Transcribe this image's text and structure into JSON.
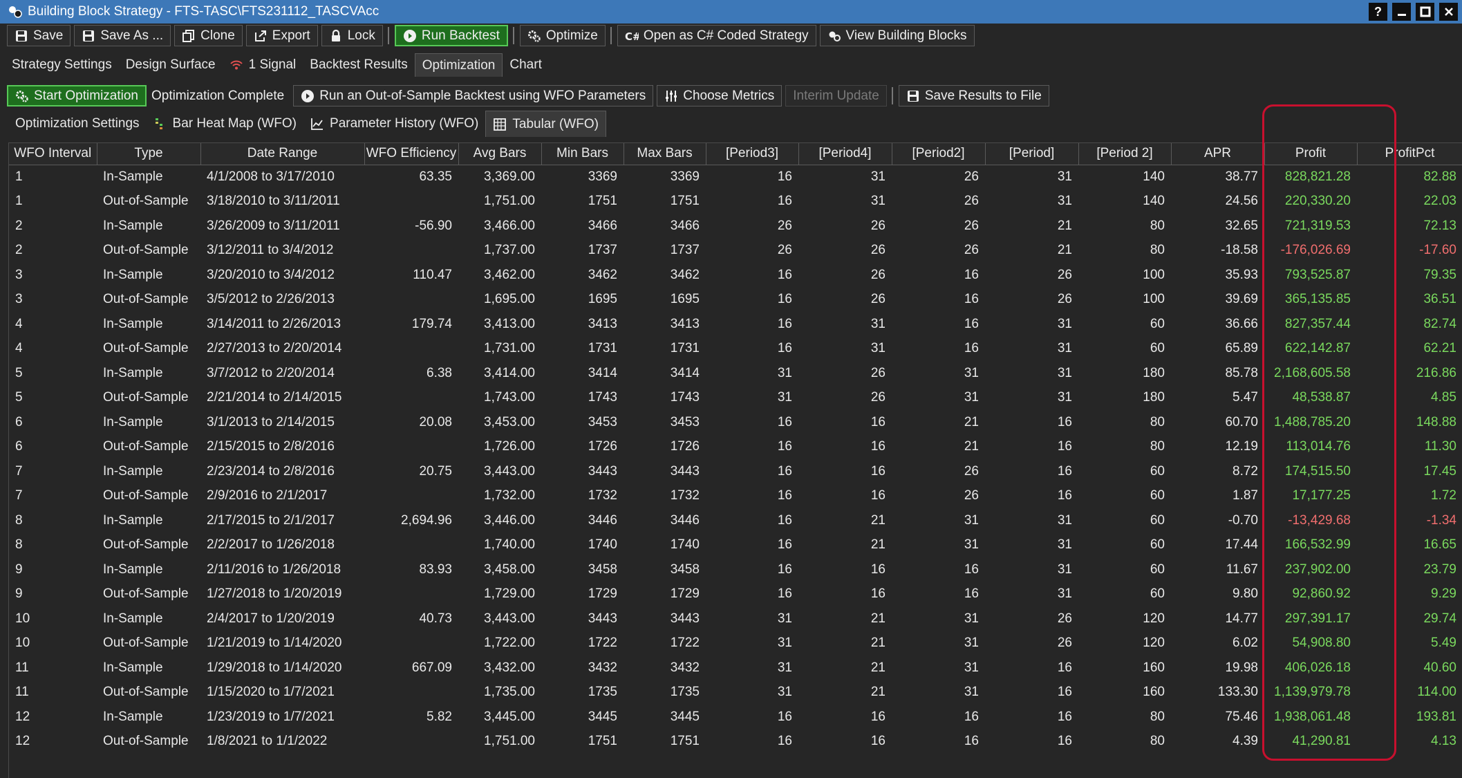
{
  "window": {
    "title": "Building Block Strategy - FTS-TASC\\FTS231112_TASCVAcc",
    "controls": {
      "help": "?",
      "minimize": "",
      "maximize": "",
      "close": ""
    }
  },
  "toolbar": {
    "save": "Save",
    "save_as": "Save As ...",
    "clone": "Clone",
    "export": "Export",
    "lock": "Lock",
    "run_backtest": "Run Backtest",
    "optimize": "Optimize",
    "open_csharp": "Open as C# Coded Strategy",
    "view_blocks": "View Building Blocks"
  },
  "main_tabs": {
    "strategy_settings": "Strategy Settings",
    "design_surface": "Design Surface",
    "signals": "1 Signal",
    "backtest_results": "Backtest Results",
    "optimization": "Optimization",
    "chart": "Chart"
  },
  "opt_toolbar": {
    "start": "Start Optimization",
    "status": "Optimization Complete",
    "oos_backtest": "Run an Out-of-Sample Backtest using WFO Parameters",
    "choose_metrics": "Choose Metrics",
    "interim_update": "Interim Update",
    "save_results": "Save Results to File"
  },
  "sub_tabs": {
    "settings": "Optimization Settings",
    "heatmap": "Bar Heat Map (WFO)",
    "history": "Parameter History (WFO)",
    "tabular": "Tabular (WFO)"
  },
  "colors": {
    "positive": "#7ad95e",
    "negative": "#f06e6e",
    "highlight": "#c8102e",
    "titlebar": "#3d78b8"
  },
  "table": {
    "columns": [
      "WFO Interval",
      "Type",
      "Date Range",
      "WFO Efficiency",
      "Avg Bars",
      "Min Bars",
      "Max Bars",
      "[Period3]",
      "[Period4]",
      "[Period2]",
      "[Period]",
      "[Period 2]",
      "APR",
      "Profit",
      "ProfitPct"
    ],
    "rows": [
      [
        "1",
        "In-Sample",
        "4/1/2008 to 3/17/2010",
        "63.35",
        "3,369.00",
        "3369",
        "3369",
        "16",
        "31",
        "26",
        "31",
        "140",
        "38.77",
        "828,821.28",
        "82.88"
      ],
      [
        "1",
        "Out-of-Sample",
        "3/18/2010 to 3/11/2011",
        "",
        "1,751.00",
        "1751",
        "1751",
        "16",
        "31",
        "26",
        "31",
        "140",
        "24.56",
        "220,330.20",
        "22.03"
      ],
      [
        "2",
        "In-Sample",
        "3/26/2009 to 3/11/2011",
        "-56.90",
        "3,466.00",
        "3466",
        "3466",
        "26",
        "26",
        "26",
        "21",
        "80",
        "32.65",
        "721,319.53",
        "72.13"
      ],
      [
        "2",
        "Out-of-Sample",
        "3/12/2011 to 3/4/2012",
        "",
        "1,737.00",
        "1737",
        "1737",
        "26",
        "26",
        "26",
        "21",
        "80",
        "-18.58",
        "-176,026.69",
        "-17.60"
      ],
      [
        "3",
        "In-Sample",
        "3/20/2010 to 3/4/2012",
        "110.47",
        "3,462.00",
        "3462",
        "3462",
        "16",
        "26",
        "16",
        "26",
        "100",
        "35.93",
        "793,525.87",
        "79.35"
      ],
      [
        "3",
        "Out-of-Sample",
        "3/5/2012 to 2/26/2013",
        "",
        "1,695.00",
        "1695",
        "1695",
        "16",
        "26",
        "16",
        "26",
        "100",
        "39.69",
        "365,135.85",
        "36.51"
      ],
      [
        "4",
        "In-Sample",
        "3/14/2011 to 2/26/2013",
        "179.74",
        "3,413.00",
        "3413",
        "3413",
        "16",
        "31",
        "16",
        "31",
        "60",
        "36.66",
        "827,357.44",
        "82.74"
      ],
      [
        "4",
        "Out-of-Sample",
        "2/27/2013 to 2/20/2014",
        "",
        "1,731.00",
        "1731",
        "1731",
        "16",
        "31",
        "16",
        "31",
        "60",
        "65.89",
        "622,142.87",
        "62.21"
      ],
      [
        "5",
        "In-Sample",
        "3/7/2012 to 2/20/2014",
        "6.38",
        "3,414.00",
        "3414",
        "3414",
        "31",
        "26",
        "31",
        "31",
        "180",
        "85.78",
        "2,168,605.58",
        "216.86"
      ],
      [
        "5",
        "Out-of-Sample",
        "2/21/2014 to 2/14/2015",
        "",
        "1,743.00",
        "1743",
        "1743",
        "31",
        "26",
        "31",
        "31",
        "180",
        "5.47",
        "48,538.87",
        "4.85"
      ],
      [
        "6",
        "In-Sample",
        "3/1/2013 to 2/14/2015",
        "20.08",
        "3,453.00",
        "3453",
        "3453",
        "16",
        "16",
        "21",
        "16",
        "80",
        "60.70",
        "1,488,785.20",
        "148.88"
      ],
      [
        "6",
        "Out-of-Sample",
        "2/15/2015 to 2/8/2016",
        "",
        "1,726.00",
        "1726",
        "1726",
        "16",
        "16",
        "21",
        "16",
        "80",
        "12.19",
        "113,014.76",
        "11.30"
      ],
      [
        "7",
        "In-Sample",
        "2/23/2014 to 2/8/2016",
        "20.75",
        "3,443.00",
        "3443",
        "3443",
        "16",
        "16",
        "26",
        "16",
        "60",
        "8.72",
        "174,515.50",
        "17.45"
      ],
      [
        "7",
        "Out-of-Sample",
        "2/9/2016 to 2/1/2017",
        "",
        "1,732.00",
        "1732",
        "1732",
        "16",
        "16",
        "26",
        "16",
        "60",
        "1.87",
        "17,177.25",
        "1.72"
      ],
      [
        "8",
        "In-Sample",
        "2/17/2015 to 2/1/2017",
        "2,694.96",
        "3,446.00",
        "3446",
        "3446",
        "16",
        "21",
        "31",
        "31",
        "60",
        "-0.70",
        "-13,429.68",
        "-1.34"
      ],
      [
        "8",
        "Out-of-Sample",
        "2/2/2017 to 1/26/2018",
        "",
        "1,740.00",
        "1740",
        "1740",
        "16",
        "21",
        "31",
        "31",
        "60",
        "17.44",
        "166,532.99",
        "16.65"
      ],
      [
        "9",
        "In-Sample",
        "2/11/2016 to 1/26/2018",
        "83.93",
        "3,458.00",
        "3458",
        "3458",
        "16",
        "16",
        "16",
        "31",
        "60",
        "11.67",
        "237,902.00",
        "23.79"
      ],
      [
        "9",
        "Out-of-Sample",
        "1/27/2018 to 1/20/2019",
        "",
        "1,729.00",
        "1729",
        "1729",
        "16",
        "16",
        "16",
        "31",
        "60",
        "9.80",
        "92,860.92",
        "9.29"
      ],
      [
        "10",
        "In-Sample",
        "2/4/2017 to 1/20/2019",
        "40.73",
        "3,443.00",
        "3443",
        "3443",
        "31",
        "21",
        "31",
        "26",
        "120",
        "14.77",
        "297,391.17",
        "29.74"
      ],
      [
        "10",
        "Out-of-Sample",
        "1/21/2019 to 1/14/2020",
        "",
        "1,722.00",
        "1722",
        "1722",
        "31",
        "21",
        "31",
        "26",
        "120",
        "6.02",
        "54,908.80",
        "5.49"
      ],
      [
        "11",
        "In-Sample",
        "1/29/2018 to 1/14/2020",
        "667.09",
        "3,432.00",
        "3432",
        "3432",
        "31",
        "21",
        "31",
        "16",
        "160",
        "19.98",
        "406,026.18",
        "40.60"
      ],
      [
        "11",
        "Out-of-Sample",
        "1/15/2020 to 1/7/2021",
        "",
        "1,735.00",
        "1735",
        "1735",
        "31",
        "21",
        "31",
        "16",
        "160",
        "133.30",
        "1,139,979.78",
        "114.00"
      ],
      [
        "12",
        "In-Sample",
        "1/23/2019 to 1/7/2021",
        "5.82",
        "3,445.00",
        "3445",
        "3445",
        "16",
        "16",
        "16",
        "16",
        "80",
        "75.46",
        "1,938,061.48",
        "193.81"
      ],
      [
        "12",
        "Out-of-Sample",
        "1/8/2021 to 1/1/2022",
        "",
        "1,751.00",
        "1751",
        "1751",
        "16",
        "16",
        "16",
        "16",
        "80",
        "4.39",
        "41,290.81",
        "4.13"
      ]
    ]
  }
}
